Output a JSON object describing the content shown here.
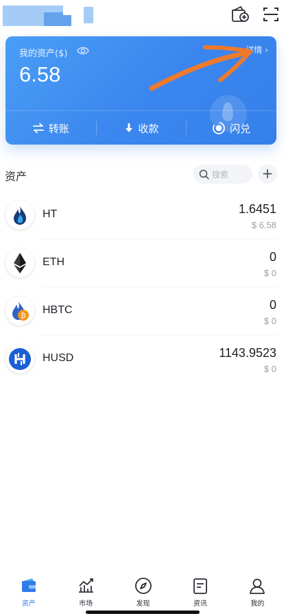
{
  "header": {
    "wallet_add_icon": "wallet-add-icon",
    "scan_icon": "scan-icon"
  },
  "card": {
    "asset_label": "我的资产($)",
    "detail_link": "详情 ›",
    "balance": "6.58",
    "actions": [
      {
        "label": "转账",
        "icon": "transfer-icon"
      },
      {
        "label": "收款",
        "icon": "receive-icon"
      },
      {
        "label": "闪兑",
        "icon": "swap-icon"
      }
    ]
  },
  "assets": {
    "title": "资产",
    "search_placeholder": "搜索",
    "add_label": "+",
    "items": [
      {
        "symbol": "HT",
        "amount": "1.6451",
        "value": "$ 6.58"
      },
      {
        "symbol": "ETH",
        "amount": "0",
        "value": "$ 0"
      },
      {
        "symbol": "HBTC",
        "amount": "0",
        "value": "$ 0"
      },
      {
        "symbol": "HUSD",
        "amount": "1143.9523",
        "value": "$ 0"
      }
    ]
  },
  "tabs": [
    {
      "label": "资产",
      "icon": "wallet-icon",
      "active": true
    },
    {
      "label": "市场",
      "icon": "chart-icon",
      "active": false
    },
    {
      "label": "发现",
      "icon": "compass-icon",
      "active": false
    },
    {
      "label": "资讯",
      "icon": "news-icon",
      "active": false
    },
    {
      "label": "我的",
      "icon": "profile-icon",
      "active": false
    }
  ],
  "colors": {
    "accent": "#2f7ce8",
    "card_start": "#4a9ef6",
    "card_end": "#3580ea",
    "annotation": "#f07a2b"
  }
}
